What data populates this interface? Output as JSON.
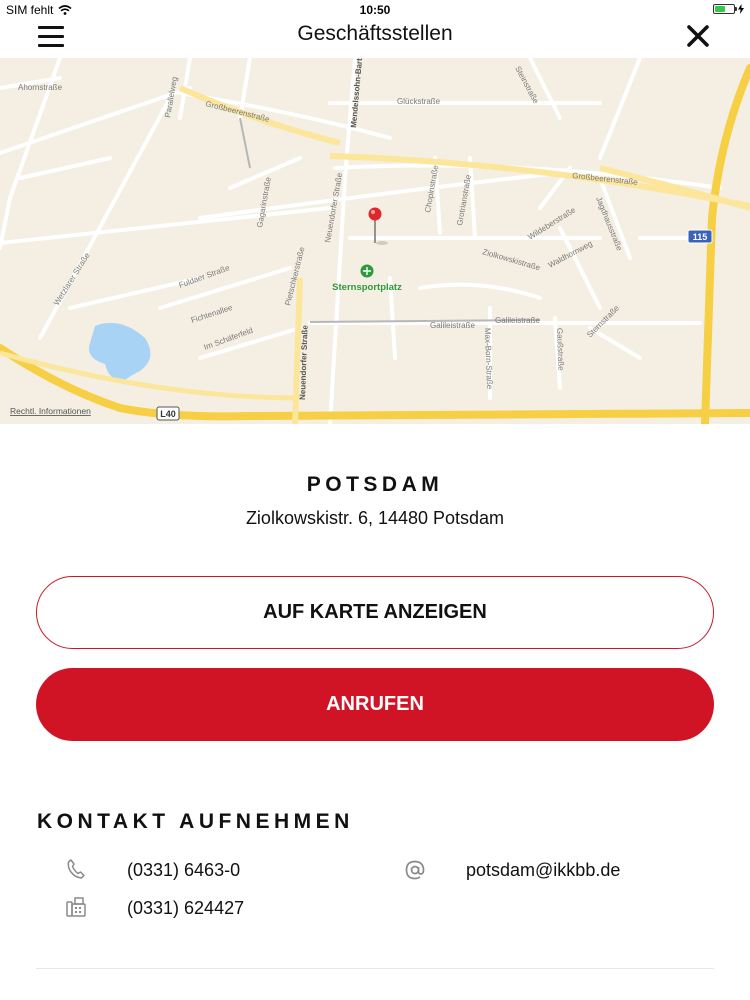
{
  "status_bar": {
    "carrier": "SIM fehlt",
    "time": "10:50"
  },
  "nav": {
    "title": "Geschäftsstellen"
  },
  "map": {
    "legal_link": "Rechtl. Informationen",
    "poi": "Sternsportplatz",
    "road_badges": [
      "115",
      "L40"
    ],
    "street_labels": [
      "Ahornstraße",
      "Großbeerenstraße",
      "Glückstraße",
      "Mendelssohn-Bart",
      "Steinstraße",
      "Parallelweg",
      "Gagarinstraße",
      "Chopinstraße",
      "Grotrianstraße",
      "Großbeerenstraße",
      "Neuendorfer Straße",
      "Wildeberstraße",
      "Jagdhausstraße",
      "Ziolkowskistraße",
      "Waldhornweg",
      "Wetzlarer Straße",
      "Fuldaer Straße",
      "Pietschkerstraße",
      "Sternstraße",
      "Fichtenallee",
      "Galileistraße",
      "Galileistraße",
      "Im Schäferfeld",
      "Gaußstraße",
      "Neuendorfer Straße",
      "Max-Born-Straße"
    ]
  },
  "office": {
    "name": "POTSDAM",
    "address": "Ziolkowskistr. 6, 14480 Potsdam"
  },
  "buttons": {
    "show_on_map": "AUF KARTE ANZEIGEN",
    "call": "ANRUFEN"
  },
  "contact": {
    "heading": "KONTAKT AUFNEHMEN",
    "phone": "(0331) 6463-0",
    "fax": "(0331) 624427",
    "email": "potsdam@ikkbb.de",
    "icons": [
      "phone-icon",
      "fax-icon",
      "at-icon"
    ]
  },
  "colors": {
    "accent": "#d01426",
    "map_background": "#f4efe2",
    "highway": "#f6cf45",
    "water": "#a9d3f5",
    "poi_green": "#2e9a3e"
  }
}
